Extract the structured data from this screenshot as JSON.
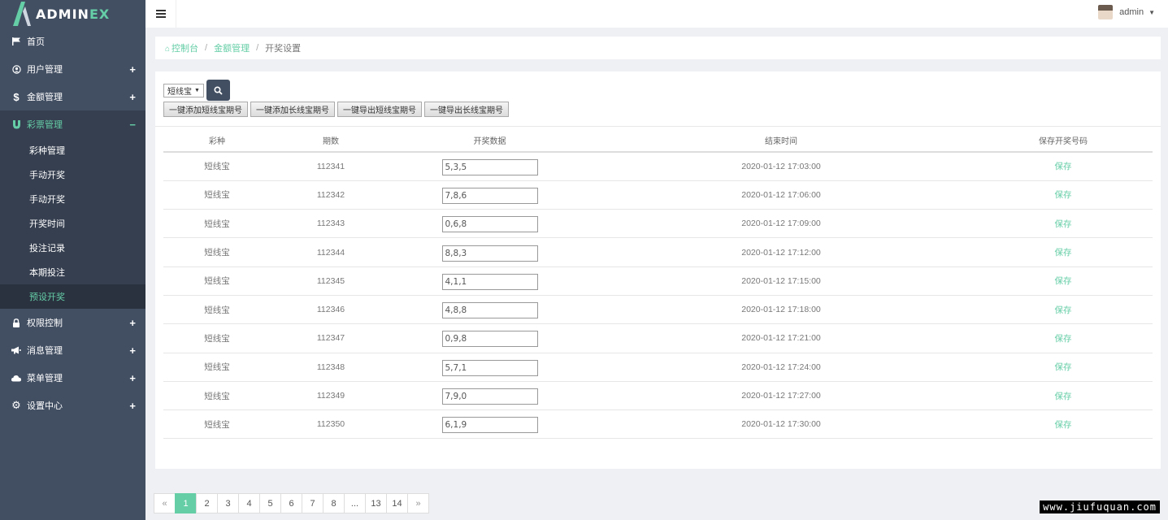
{
  "app": {
    "logo_prefix": "ADMIN",
    "logo_suffix": "EX"
  },
  "colors": {
    "accent": "#65cea7",
    "sidebar": "#424f63",
    "sidebar_active": "#353f4f"
  },
  "header": {
    "user_name": "admin"
  },
  "sidebar": {
    "items": [
      {
        "label": "首页",
        "icon": "flag-icon"
      },
      {
        "label": "用户管理",
        "icon": "user-circle-icon",
        "expand": "+"
      },
      {
        "label": "金额管理",
        "icon": "dollar-icon",
        "expand": "+"
      },
      {
        "label": "彩票管理",
        "icon": "magnet-icon",
        "expand": "−"
      },
      {
        "label": "权限控制",
        "icon": "lock-icon",
        "expand": "+"
      },
      {
        "label": "消息管理",
        "icon": "bullhorn-icon",
        "expand": "+"
      },
      {
        "label": "菜单管理",
        "icon": "cloud-icon",
        "expand": "+"
      },
      {
        "label": "设置中心",
        "icon": "gear-icon",
        "expand": "+"
      }
    ],
    "sub_items": [
      "彩种管理",
      "手动开奖",
      "手动开奖",
      "开奖时间",
      "投注记录",
      "本期投注",
      "预设开奖"
    ]
  },
  "breadcrumb": {
    "home": "控制台",
    "section": "金额管理",
    "current": "开奖设置"
  },
  "filter": {
    "selected": "短线宝"
  },
  "actions": [
    "一键添加短线宝期号",
    "一键添加长线宝期号",
    "一键导出短线宝期号",
    "一键导出长线宝期号"
  ],
  "table": {
    "headers": [
      "彩种",
      "期数",
      "开奖数据",
      "结束时间",
      "保存开奖号码"
    ],
    "save_label": "保存",
    "rows": [
      {
        "type": "短线宝",
        "period": "112341",
        "data": "5,3,5",
        "end": "2020-01-12 17:03:00"
      },
      {
        "type": "短线宝",
        "period": "112342",
        "data": "7,8,6",
        "end": "2020-01-12 17:06:00"
      },
      {
        "type": "短线宝",
        "period": "112343",
        "data": "0,6,8",
        "end": "2020-01-12 17:09:00"
      },
      {
        "type": "短线宝",
        "period": "112344",
        "data": "8,8,3",
        "end": "2020-01-12 17:12:00"
      },
      {
        "type": "短线宝",
        "period": "112345",
        "data": "4,1,1",
        "end": "2020-01-12 17:15:00"
      },
      {
        "type": "短线宝",
        "period": "112346",
        "data": "4,8,8",
        "end": "2020-01-12 17:18:00"
      },
      {
        "type": "短线宝",
        "period": "112347",
        "data": "0,9,8",
        "end": "2020-01-12 17:21:00"
      },
      {
        "type": "短线宝",
        "period": "112348",
        "data": "5,7,1",
        "end": "2020-01-12 17:24:00"
      },
      {
        "type": "短线宝",
        "period": "112349",
        "data": "7,9,0",
        "end": "2020-01-12 17:27:00"
      },
      {
        "type": "短线宝",
        "period": "112350",
        "data": "6,1,9",
        "end": "2020-01-12 17:30:00"
      }
    ]
  },
  "pagination": [
    "«",
    "1",
    "2",
    "3",
    "4",
    "5",
    "6",
    "7",
    "8",
    "...",
    "13",
    "14",
    "»"
  ],
  "pagination_active": "1",
  "watermark": "www.jiufuquan.com"
}
